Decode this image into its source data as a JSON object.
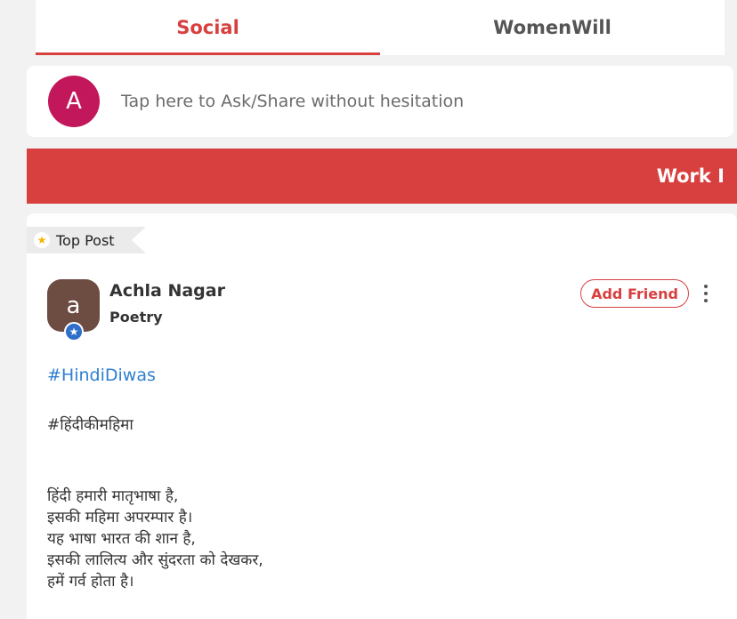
{
  "tabs": [
    {
      "label": "Social",
      "active": true
    },
    {
      "label": "WomenWill",
      "active": false
    }
  ],
  "ask": {
    "avatar_letter": "A",
    "placeholder": "Tap here to Ask/Share without hesitation"
  },
  "banner": {
    "text": "Work I"
  },
  "post": {
    "badge_label": "Top Post",
    "author": {
      "avatar_letter": "a",
      "name": "Achla Nagar",
      "category": "Poetry"
    },
    "add_friend_label": "Add Friend",
    "hashtag": "#HindiDiwas",
    "tag_line": "#हिंदीकीमहिमा",
    "lines": [
      "हिंदी हमारी मातृभाषा है,",
      "इसकी महिमा अपरम्पार है।",
      "यह भाषा भारत की शान है,",
      "इसकी लालित्य और सुंदरता को देखकर,",
      "हमें गर्व होता है।"
    ]
  },
  "colors": {
    "accent": "#d84040",
    "link": "#2f7fd0",
    "ask_avatar": "#c2185b",
    "author_avatar": "#6d4c41",
    "verified": "#2f6fc9"
  },
  "icons": {
    "top_post": "star-icon",
    "verified": "verified-star-icon",
    "more": "more-vertical-icon"
  }
}
